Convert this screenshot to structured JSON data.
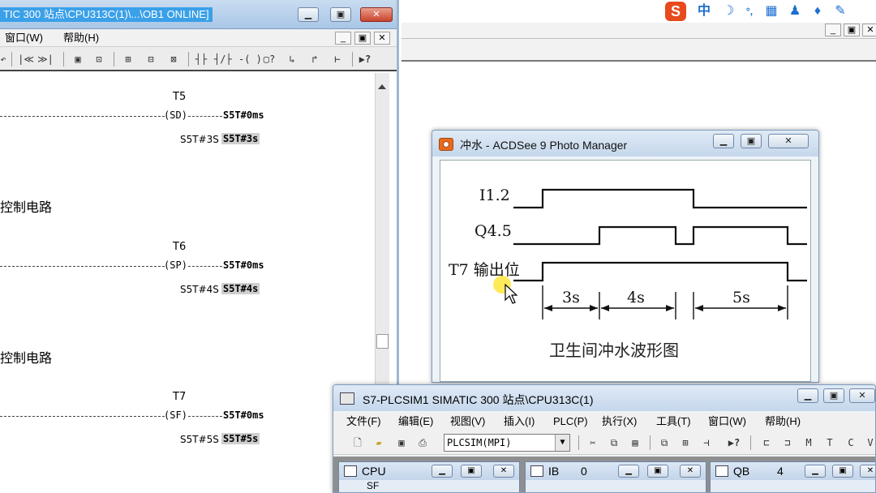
{
  "editor": {
    "title": "TIC 300 站点\\CPU313C(1)\\...\\OB1  ONLINE]",
    "menu": {
      "window": "窗口(W)",
      "help": "帮助(H)"
    },
    "toolbar": {
      "icons": [
        "undo-icon",
        "first-icon",
        "last-icon",
        "view-icon",
        "zoom-icon",
        "network-icon",
        "insert-row-icon",
        "delete-row-icon",
        "no-contact-icon",
        "nc-contact-icon",
        "coil-icon",
        "box-icon",
        "branch-open-icon",
        "branch-close-icon",
        "connection-icon",
        "help-icon"
      ],
      "glyphs": [
        "↶",
        "|≪",
        "≫|",
        "▣",
        "⊡",
        "⊞",
        "⊟",
        "⊠",
        "┤├",
        "┤/├",
        "-( )",
        "▢?",
        "↳",
        "↱",
        "⊢",
        "▶?"
      ]
    },
    "networks": [
      {
        "timer": "T5",
        "coil": "SD",
        "running_value": "S5T#0ms",
        "preset_label": "S5T#3S",
        "preset_value": "S5T#3s"
      },
      {
        "timer": "T6",
        "coil": "SP",
        "running_value": "S5T#0ms",
        "preset_label": "S5T#4S",
        "preset_value": "S5T#4s"
      },
      {
        "timer": "T7",
        "coil": "SF",
        "running_value": "S5T#0ms",
        "preset_label": "S5T#5S",
        "preset_value": "S5T#5s"
      }
    ],
    "section_titles": [
      "控制电路",
      "控制电路"
    ]
  },
  "ime": {
    "logo": "S",
    "mode": "中",
    "glyphs": [
      "☽",
      "°,",
      "▦",
      "♟",
      "♦",
      "✎"
    ]
  },
  "acdsee": {
    "title": "冲水 - ACDSee 9 Photo Manager",
    "waveform": {
      "signals": [
        "I1.2",
        "Q4.5",
        "T7 输出位"
      ],
      "durations": [
        "3s",
        "4s",
        "5s"
      ],
      "caption": "卫生间冲水波形图"
    }
  },
  "plcsim": {
    "title": "S7-PLCSIM1    SIMATIC 300 站点\\CPU313C(1)",
    "menu": [
      "文件(F)",
      "编辑(E)",
      "视图(V)",
      "插入(I)",
      "PLC(P)",
      "执行(X)",
      "工具(T)",
      "窗口(W)",
      "帮助(H)"
    ],
    "interface": "PLCSIM(MPI)",
    "subwindows": [
      {
        "label": "CPU",
        "value": ""
      },
      {
        "label": "IB",
        "value": "0"
      },
      {
        "label": "QB",
        "value": "4"
      }
    ],
    "cpu_peek": "SF"
  },
  "colors": {
    "title_active": "#3aa0e8",
    "close_red": "#c8432b",
    "waveform": "#111111"
  }
}
